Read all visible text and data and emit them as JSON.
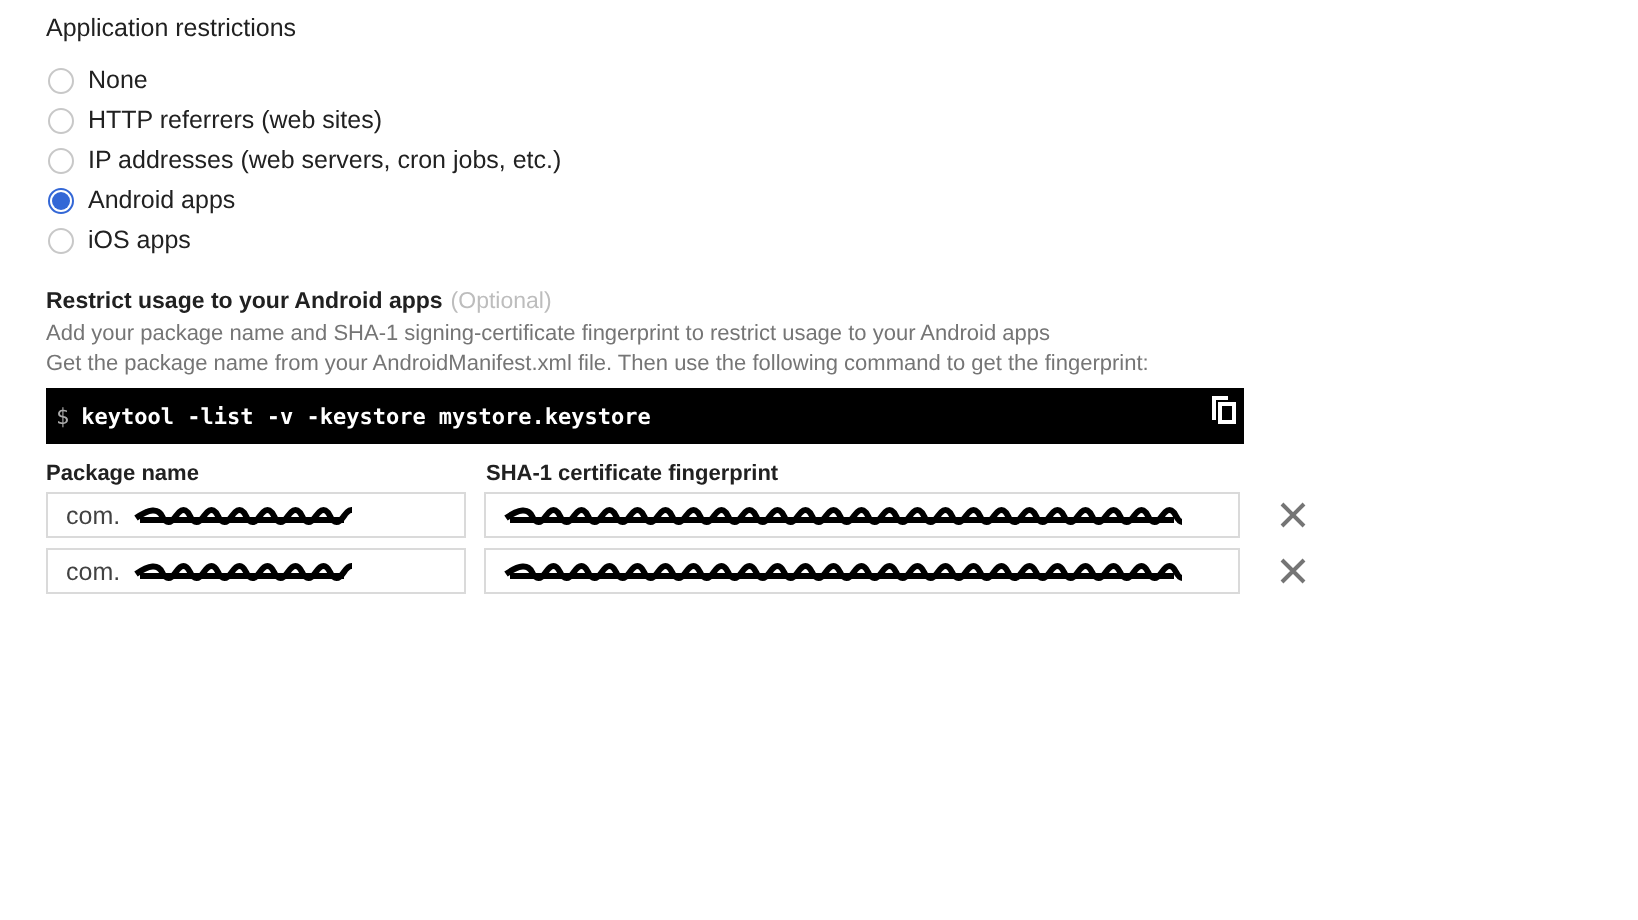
{
  "section_title": "Application restrictions",
  "options": [
    {
      "label": "None",
      "selected": false
    },
    {
      "label": "HTTP referrers (web sites)",
      "selected": false
    },
    {
      "label": "IP addresses (web servers, cron jobs, etc.)",
      "selected": false
    },
    {
      "label": "Android apps",
      "selected": true
    },
    {
      "label": "iOS apps",
      "selected": false
    }
  ],
  "android": {
    "title": "Restrict usage to your Android apps",
    "optional": "(Optional)",
    "description": [
      "Add your package name and SHA-1 signing-certificate fingerprint to restrict usage to your Android apps",
      "Get the package name from your AndroidManifest.xml file. Then use the following command to get the fingerprint:"
    ],
    "command": {
      "prompt": "$",
      "text": "keytool -list -v -keystore mystore.keystore"
    },
    "columns": [
      "Package name",
      "SHA-1 certificate fingerprint"
    ],
    "rows": [
      {
        "package": "com."
      },
      {
        "package": "com."
      }
    ]
  }
}
